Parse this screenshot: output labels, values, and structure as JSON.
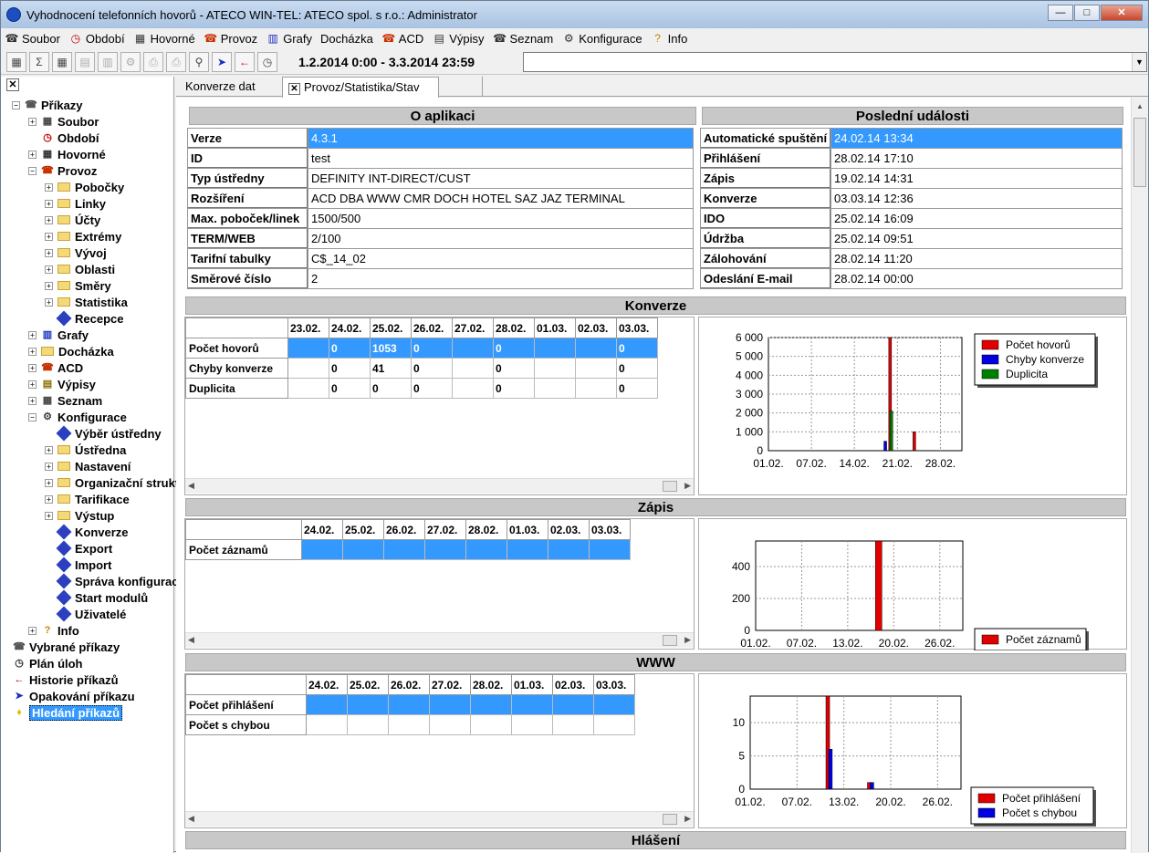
{
  "window": {
    "title": "Vyhodnocení telefonních hovorů - ATECO WIN-TEL: ATECO spol. s r.o.: Administrator"
  },
  "menu": [
    {
      "label": "Soubor",
      "icon": "phone-book-icon"
    },
    {
      "label": "Období",
      "icon": "clock-icon"
    },
    {
      "label": "Hovorné",
      "icon": "calculator-icon"
    },
    {
      "label": "Provoz",
      "icon": "phone-icon"
    },
    {
      "label": "Grafy",
      "icon": "chart-icon"
    },
    {
      "label": "Docházka",
      "icon": ""
    },
    {
      "label": "ACD",
      "icon": "phone-icon"
    },
    {
      "label": "Výpisy",
      "icon": "folders-icon"
    },
    {
      "label": "Seznam",
      "icon": "phone-book-icon"
    },
    {
      "label": "Konfigurace",
      "icon": "config-icon"
    },
    {
      "label": "Info",
      "icon": "help-icon"
    }
  ],
  "toolbar": {
    "date_range": "1.2.2014 0:00 - 3.3.2014 23:59"
  },
  "tree": [
    {
      "label": "Příkazy",
      "level": 0,
      "exp": "-",
      "icon": "root"
    },
    {
      "label": "Soubor",
      "level": 1,
      "exp": "+",
      "icon": "app"
    },
    {
      "label": "Období",
      "level": 1,
      "exp": "",
      "icon": "clock"
    },
    {
      "label": "Hovorné",
      "level": 1,
      "exp": "+",
      "icon": "calc"
    },
    {
      "label": "Provoz",
      "level": 1,
      "exp": "-",
      "icon": "phone"
    },
    {
      "label": "Pobočky",
      "level": 2,
      "exp": "+",
      "icon": "folder"
    },
    {
      "label": "Linky",
      "level": 2,
      "exp": "+",
      "icon": "folder"
    },
    {
      "label": "Účty",
      "level": 2,
      "exp": "+",
      "icon": "folder"
    },
    {
      "label": "Extrémy",
      "level": 2,
      "exp": "+",
      "icon": "folder"
    },
    {
      "label": "Vývoj",
      "level": 2,
      "exp": "+",
      "icon": "folder"
    },
    {
      "label": "Oblasti",
      "level": 2,
      "exp": "+",
      "icon": "folder"
    },
    {
      "label": "Směry",
      "level": 2,
      "exp": "+",
      "icon": "folder"
    },
    {
      "label": "Statistika",
      "level": 2,
      "exp": "+",
      "icon": "folder"
    },
    {
      "label": "Recepce",
      "level": 2,
      "exp": "",
      "icon": "cmd"
    },
    {
      "label": "Grafy",
      "level": 1,
      "exp": "+",
      "icon": "chart"
    },
    {
      "label": "Docházka",
      "level": 1,
      "exp": "+",
      "icon": "folder"
    },
    {
      "label": "ACD",
      "level": 1,
      "exp": "+",
      "icon": "phone"
    },
    {
      "label": "Výpisy",
      "level": 1,
      "exp": "+",
      "icon": "folders"
    },
    {
      "label": "Seznam",
      "level": 1,
      "exp": "+",
      "icon": "app"
    },
    {
      "label": "Konfigurace",
      "level": 1,
      "exp": "-",
      "icon": "config"
    },
    {
      "label": "Výběr ústředny",
      "level": 2,
      "exp": "",
      "icon": "cmd"
    },
    {
      "label": "Ústředna",
      "level": 2,
      "exp": "+",
      "icon": "folder"
    },
    {
      "label": "Nastavení",
      "level": 2,
      "exp": "+",
      "icon": "folder"
    },
    {
      "label": "Organizační struktura",
      "level": 2,
      "exp": "+",
      "icon": "folder"
    },
    {
      "label": "Tarifikace",
      "level": 2,
      "exp": "+",
      "icon": "folder"
    },
    {
      "label": "Výstup",
      "level": 2,
      "exp": "+",
      "icon": "folder"
    },
    {
      "label": "Konverze",
      "level": 2,
      "exp": "",
      "icon": "cmd"
    },
    {
      "label": "Export",
      "level": 2,
      "exp": "",
      "icon": "cmd"
    },
    {
      "label": "Import",
      "level": 2,
      "exp": "",
      "icon": "cmd"
    },
    {
      "label": "Správa konfigurace",
      "level": 2,
      "exp": "",
      "icon": "cmd"
    },
    {
      "label": "Start modulů",
      "level": 2,
      "exp": "",
      "icon": "cmd"
    },
    {
      "label": "Uživatelé",
      "level": 2,
      "exp": "",
      "icon": "cmd"
    },
    {
      "label": "Info",
      "level": 1,
      "exp": "+",
      "icon": "help"
    },
    {
      "label": "Vybrané příkazy",
      "level": 0,
      "exp": "",
      "icon": "root"
    },
    {
      "label": "Plán úloh",
      "level": 0,
      "exp": "",
      "icon": "clock2"
    },
    {
      "label": "Historie příkazů",
      "level": 0,
      "exp": "",
      "icon": "back"
    },
    {
      "label": "Opakování příkazu",
      "level": 0,
      "exp": "",
      "icon": "back2"
    },
    {
      "label": "Hledání příkazů",
      "level": 0,
      "exp": "",
      "icon": "bulb",
      "selected": true
    }
  ],
  "tabs": [
    {
      "label": "Konverze dat",
      "active": false
    },
    {
      "label": "Provoz/Statistika/Stav",
      "active": true
    }
  ],
  "about": {
    "title": "O aplikaci",
    "rows": [
      {
        "k": "Verze",
        "v": "4.3.1"
      },
      {
        "k": "ID",
        "v": "test"
      },
      {
        "k": "Typ ústředny",
        "v": "DEFINITY INT-DIRECT/CUST"
      },
      {
        "k": "Rozšíření",
        "v": "ACD DBA WWW CMR DOCH HOTEL SAZ JAZ TERMINAL"
      },
      {
        "k": "Max. poboček/linek",
        "v": "1500/500"
      },
      {
        "k": "TERM/WEB",
        "v": "2/100"
      },
      {
        "k": "Tarifní tabulky",
        "v": "C$_14_02"
      },
      {
        "k": "Směrové číslo",
        "v": "2"
      }
    ]
  },
  "events": {
    "title": "Poslední události",
    "rows": [
      {
        "k": "Automatické spuštění",
        "v": "24.02.14 13:34"
      },
      {
        "k": "Přihlášení",
        "v": "28.02.14 17:10"
      },
      {
        "k": "Zápis",
        "v": "19.02.14 14:31"
      },
      {
        "k": "Konverze",
        "v": "03.03.14 12:36"
      },
      {
        "k": "IDO",
        "v": "25.02.14 16:09"
      },
      {
        "k": "Údržba",
        "v": "25.02.14 09:51"
      },
      {
        "k": "Zálohování",
        "v": "28.02.14 11:20"
      },
      {
        "k": "Odeslání E-mail",
        "v": "28.02.14 00:00"
      }
    ]
  },
  "konverze": {
    "title": "Konverze",
    "columns": [
      "23.02.",
      "24.02.",
      "25.02.",
      "26.02.",
      "27.02.",
      "28.02.",
      "01.03.",
      "02.03.",
      "03.03."
    ],
    "rows": [
      {
        "label": "Počet hovorů",
        "cells": [
          "",
          "0",
          "1053",
          "0",
          "",
          "0",
          "",
          "",
          "0"
        ]
      },
      {
        "label": "Chyby konverze",
        "cells": [
          "",
          "0",
          "41",
          "0",
          "",
          "0",
          "",
          "",
          "0"
        ]
      },
      {
        "label": "Duplicita",
        "cells": [
          "",
          "0",
          "0",
          "0",
          "",
          "0",
          "",
          "",
          "0"
        ]
      }
    ]
  },
  "zapis": {
    "title": "Zápis",
    "columns": [
      "24.02.",
      "25.02.",
      "26.02.",
      "27.02.",
      "28.02.",
      "01.03.",
      "02.03.",
      "03.03."
    ],
    "rows": [
      {
        "label": "Počet záznamů",
        "cells": [
          "",
          "",
          "",
          "",
          "",
          "",
          "",
          ""
        ]
      }
    ]
  },
  "www": {
    "title": "WWW",
    "columns": [
      "24.02.",
      "25.02.",
      "26.02.",
      "27.02.",
      "28.02.",
      "01.03.",
      "02.03.",
      "03.03."
    ],
    "rows": [
      {
        "label": "Počet přihlášení",
        "cells": [
          "",
          "",
          "",
          "",
          "",
          "",
          "",
          ""
        ]
      },
      {
        "label": "Počet s chybou",
        "cells": [
          "",
          "",
          "",
          "",
          "",
          "",
          "",
          ""
        ]
      }
    ]
  },
  "hlaseni": {
    "title": "Hlášení"
  },
  "chart_data": [
    {
      "type": "bar",
      "x_ticks": [
        "01.02.",
        "07.02.",
        "14.02.",
        "21.02.",
        "28.02."
      ],
      "y_ticks": [
        "0",
        "1 000",
        "2 000",
        "3 000",
        "4 000",
        "5 000",
        "6 000"
      ],
      "ylim": [
        0,
        6000
      ],
      "xlim_days": [
        0,
        32
      ],
      "legend_position": "top-right",
      "grid": true,
      "series": [
        {
          "name": "Počet hovorů",
          "color": "#e00000",
          "points": [
            [
              19.9,
              6300
            ],
            [
              23.9,
              1000
            ]
          ]
        },
        {
          "name": "Chyby konverze",
          "color": "#0000e0",
          "points": [
            [
              19.1,
              500
            ]
          ]
        },
        {
          "name": "Duplicita",
          "color": "#008000",
          "points": [
            [
              20.1,
              2100
            ]
          ]
        }
      ]
    },
    {
      "type": "bar",
      "x_ticks": [
        "01.02.",
        "07.02.",
        "13.02.",
        "20.02.",
        "26.02."
      ],
      "y_ticks": [
        "0",
        "200",
        "400"
      ],
      "ylim": [
        0,
        560
      ],
      "xlim_days": [
        0,
        32
      ],
      "legend_position": "top-right",
      "grid": true,
      "series": [
        {
          "name": "Počet záznamů",
          "color": "#e00000",
          "points": [
            [
              18.5,
              560
            ]
          ]
        }
      ]
    },
    {
      "type": "bar",
      "x_ticks": [
        "01.02.",
        "07.02.",
        "13.02.",
        "20.02.",
        "26.02."
      ],
      "y_ticks": [
        "0",
        "5",
        "10"
      ],
      "ylim": [
        0,
        14
      ],
      "xlim_days": [
        0,
        32
      ],
      "legend_position": "top-right",
      "grid": true,
      "series": [
        {
          "name": "Počet přihlášení",
          "color": "#e00000",
          "points": [
            [
              11.5,
              14
            ],
            [
              17.8,
              1
            ]
          ]
        },
        {
          "name": "Počet s chybou",
          "color": "#0000e0",
          "points": [
            [
              11.9,
              6
            ],
            [
              18.2,
              1
            ]
          ]
        }
      ]
    }
  ]
}
